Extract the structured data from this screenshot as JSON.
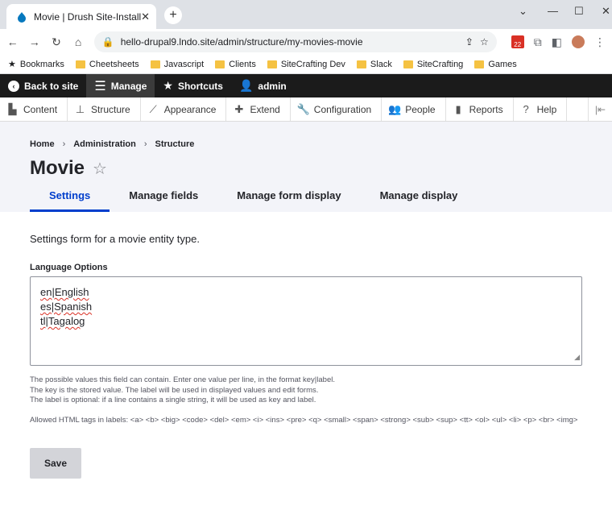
{
  "browser": {
    "tab_title": "Movie | Drush Site-Install",
    "url": "hello-drupal9.lndo.site/admin/structure/my-movies-movie",
    "ext_badge": "22",
    "bookmarks": [
      "Bookmarks",
      "Cheetsheets",
      "Javascript",
      "Clients",
      "SiteCrafting Dev",
      "Slack",
      "SiteCrafting",
      "Games"
    ]
  },
  "toolbar": {
    "back": "Back to site",
    "manage": "Manage",
    "shortcuts": "Shortcuts",
    "user": "admin"
  },
  "tray": {
    "items": [
      "Content",
      "Structure",
      "Appearance",
      "Extend",
      "Configuration",
      "People",
      "Reports",
      "Help"
    ]
  },
  "page": {
    "breadcrumbs": [
      "Home",
      "Administration",
      "Structure"
    ],
    "title": "Movie",
    "tabs": [
      "Settings",
      "Manage fields",
      "Manage form display",
      "Manage display"
    ],
    "description": "Settings form for a movie entity type.",
    "field_label": "Language Options",
    "field_lines": [
      "en|English",
      "es|Spanish",
      "tl|Tagalog"
    ],
    "help_lines": [
      "The possible values this field can contain. Enter one value per line, in the format key|label.",
      "The key is the stored value. The label will be used in displayed values and edit forms.",
      "The label is optional: if a line contains a single string, it will be used as key and label."
    ],
    "allowed_tags": "Allowed HTML tags in labels: <a> <b> <big> <code> <del> <em> <i> <ins> <pre> <q> <small> <span> <strong> <sub> <sup> <tt> <ol> <ul> <li> <p> <br> <img>",
    "save_label": "Save"
  },
  "colors": {
    "accent": "#003ecc",
    "toolbar_bg": "#1b1b1b",
    "header_bg": "#f3f4f9"
  }
}
